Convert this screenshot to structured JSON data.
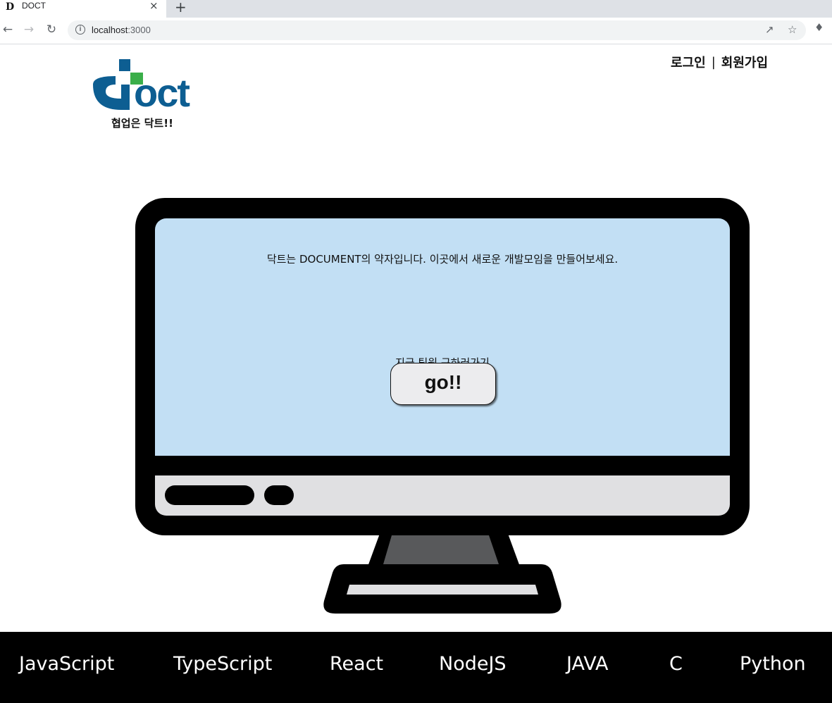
{
  "browser": {
    "tab_favicon": "D",
    "tab_title": "DOCT",
    "tab_close": "×",
    "new_tab": "+",
    "url_host": "localhost",
    "url_port": ":3000"
  },
  "header": {
    "logo_text": "oct",
    "tagline": "협업은 닥트!!",
    "login_label": "로그인",
    "separator": "|",
    "signup_label": "회원가입"
  },
  "monitor": {
    "intro_text": "닥트는 DOCUMENT의 약자입니다. 이곳에서 새로운 개발모임을 만들어보세요.",
    "recruit_text": "지금 팀원 구하러가기",
    "go_button_label": "go!!"
  },
  "footer": {
    "tags": [
      "JavaScript",
      "TypeScript",
      "React",
      "NodeJS",
      "JAVA",
      "C",
      "Python"
    ]
  },
  "colors": {
    "screen": "#c2dff4",
    "logo_blue": "#0d5e92",
    "logo_green": "#3aae49",
    "footer_bg": "#000000"
  }
}
